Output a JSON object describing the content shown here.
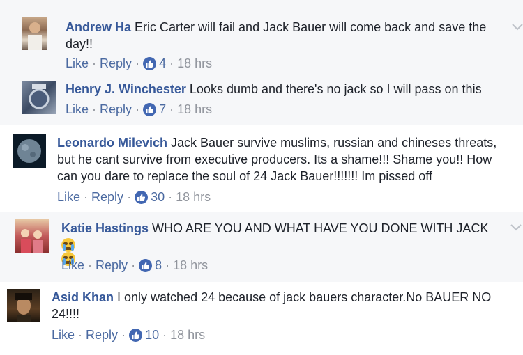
{
  "comments": [
    {
      "author": "Andrew Ha",
      "text": " Eric Carter will fail and Jack Bauer will come back and save the day!!",
      "like": "Like",
      "reply": "Reply",
      "reactions": "4",
      "time": "18 hrs"
    },
    {
      "author": "Henry J. Winchester",
      "text": " Looks dumb and there's no jack so I will pass on this",
      "like": "Like",
      "reply": "Reply",
      "reactions": "7",
      "time": "18 hrs"
    },
    {
      "author": "Leonardo Milevich",
      "text": " Jack Bauer survive muslims, russian and chineses threats, but he cant survive from executive producers. Its a shame!!! Shame you!! How can you dare to replace the soul of 24 Jack Bauer!!!!!!! Im pissed off",
      "like": "Like",
      "reply": "Reply",
      "reactions": "30",
      "time": "18 hrs"
    },
    {
      "author": "Katie Hastings",
      "text": " WHO ARE YOU AND WHAT HAVE YOU DONE WITH JACK",
      "like": "Like",
      "reply": "Reply",
      "reactions": "8",
      "time": "18 hrs"
    },
    {
      "author": "Asid Khan",
      "text": " I only watched 24 because of jack bauers character.No BAUER NO 24!!!!",
      "like": "Like",
      "reply": "Reply",
      "reactions": "10",
      "time": "18 hrs"
    }
  ],
  "icons": {
    "like_badge": "thumbs-up-icon",
    "menu": "chevron-down-icon",
    "emoji": "crying-face-icon"
  },
  "colors": {
    "author": "#365899",
    "meta": "#90949c",
    "like_badge": "#4267b2"
  }
}
